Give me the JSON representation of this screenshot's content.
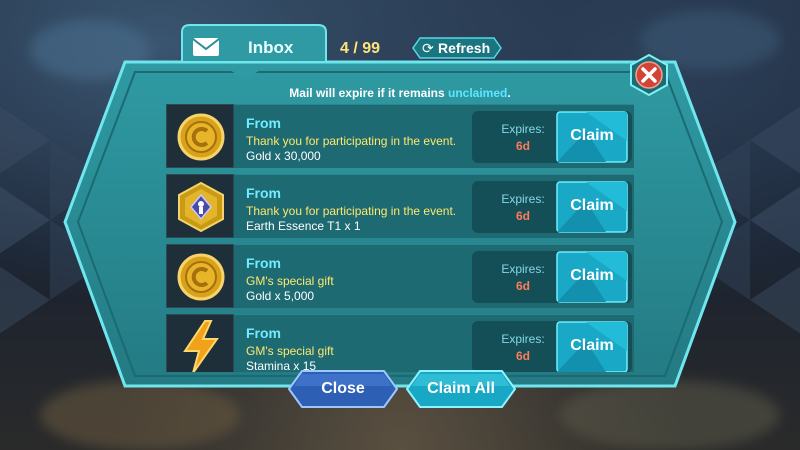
{
  "header": {
    "tab_label": "Inbox",
    "count": "4 / 99",
    "refresh_label": "Refresh"
  },
  "notice": {
    "prefix": "Mail will expire if it remains ",
    "highlight": "unclaimed",
    "suffix": "."
  },
  "mails": [
    {
      "from": "From",
      "subject": "Thank you for participating in the event.",
      "item": "Gold x 30,000",
      "expires_label": "Expires:",
      "expires_value": "6d",
      "claim_label": "Claim",
      "icon": "gold-coin-icon"
    },
    {
      "from": "From",
      "subject": "Thank you for participating in the event.",
      "item": "Earth Essence T1 x 1",
      "expires_label": "Expires:",
      "expires_value": "6d",
      "claim_label": "Claim",
      "icon": "earth-essence-icon"
    },
    {
      "from": "From",
      "subject": "GM's special gift",
      "item": "Gold x 5,000",
      "expires_label": "Expires:",
      "expires_value": "6d",
      "claim_label": "Claim",
      "icon": "gold-coin-icon"
    },
    {
      "from": "From",
      "subject": "GM's special gift",
      "item": "Stamina x 15",
      "expires_label": "Expires:",
      "expires_value": "6d",
      "claim_label": "Claim",
      "icon": "lightning-bolt-icon"
    }
  ],
  "footer": {
    "close_label": "Close",
    "claim_all_label": "Claim All"
  },
  "colors": {
    "panel": "#2a8c95",
    "panel_border": "#5fe0e8",
    "row_body": "#1d6a73",
    "claim_button": "#1ab8d6",
    "expires_value": "#ff7b5a",
    "subject_text": "#ffe86a",
    "close_x": "#c0392b"
  }
}
